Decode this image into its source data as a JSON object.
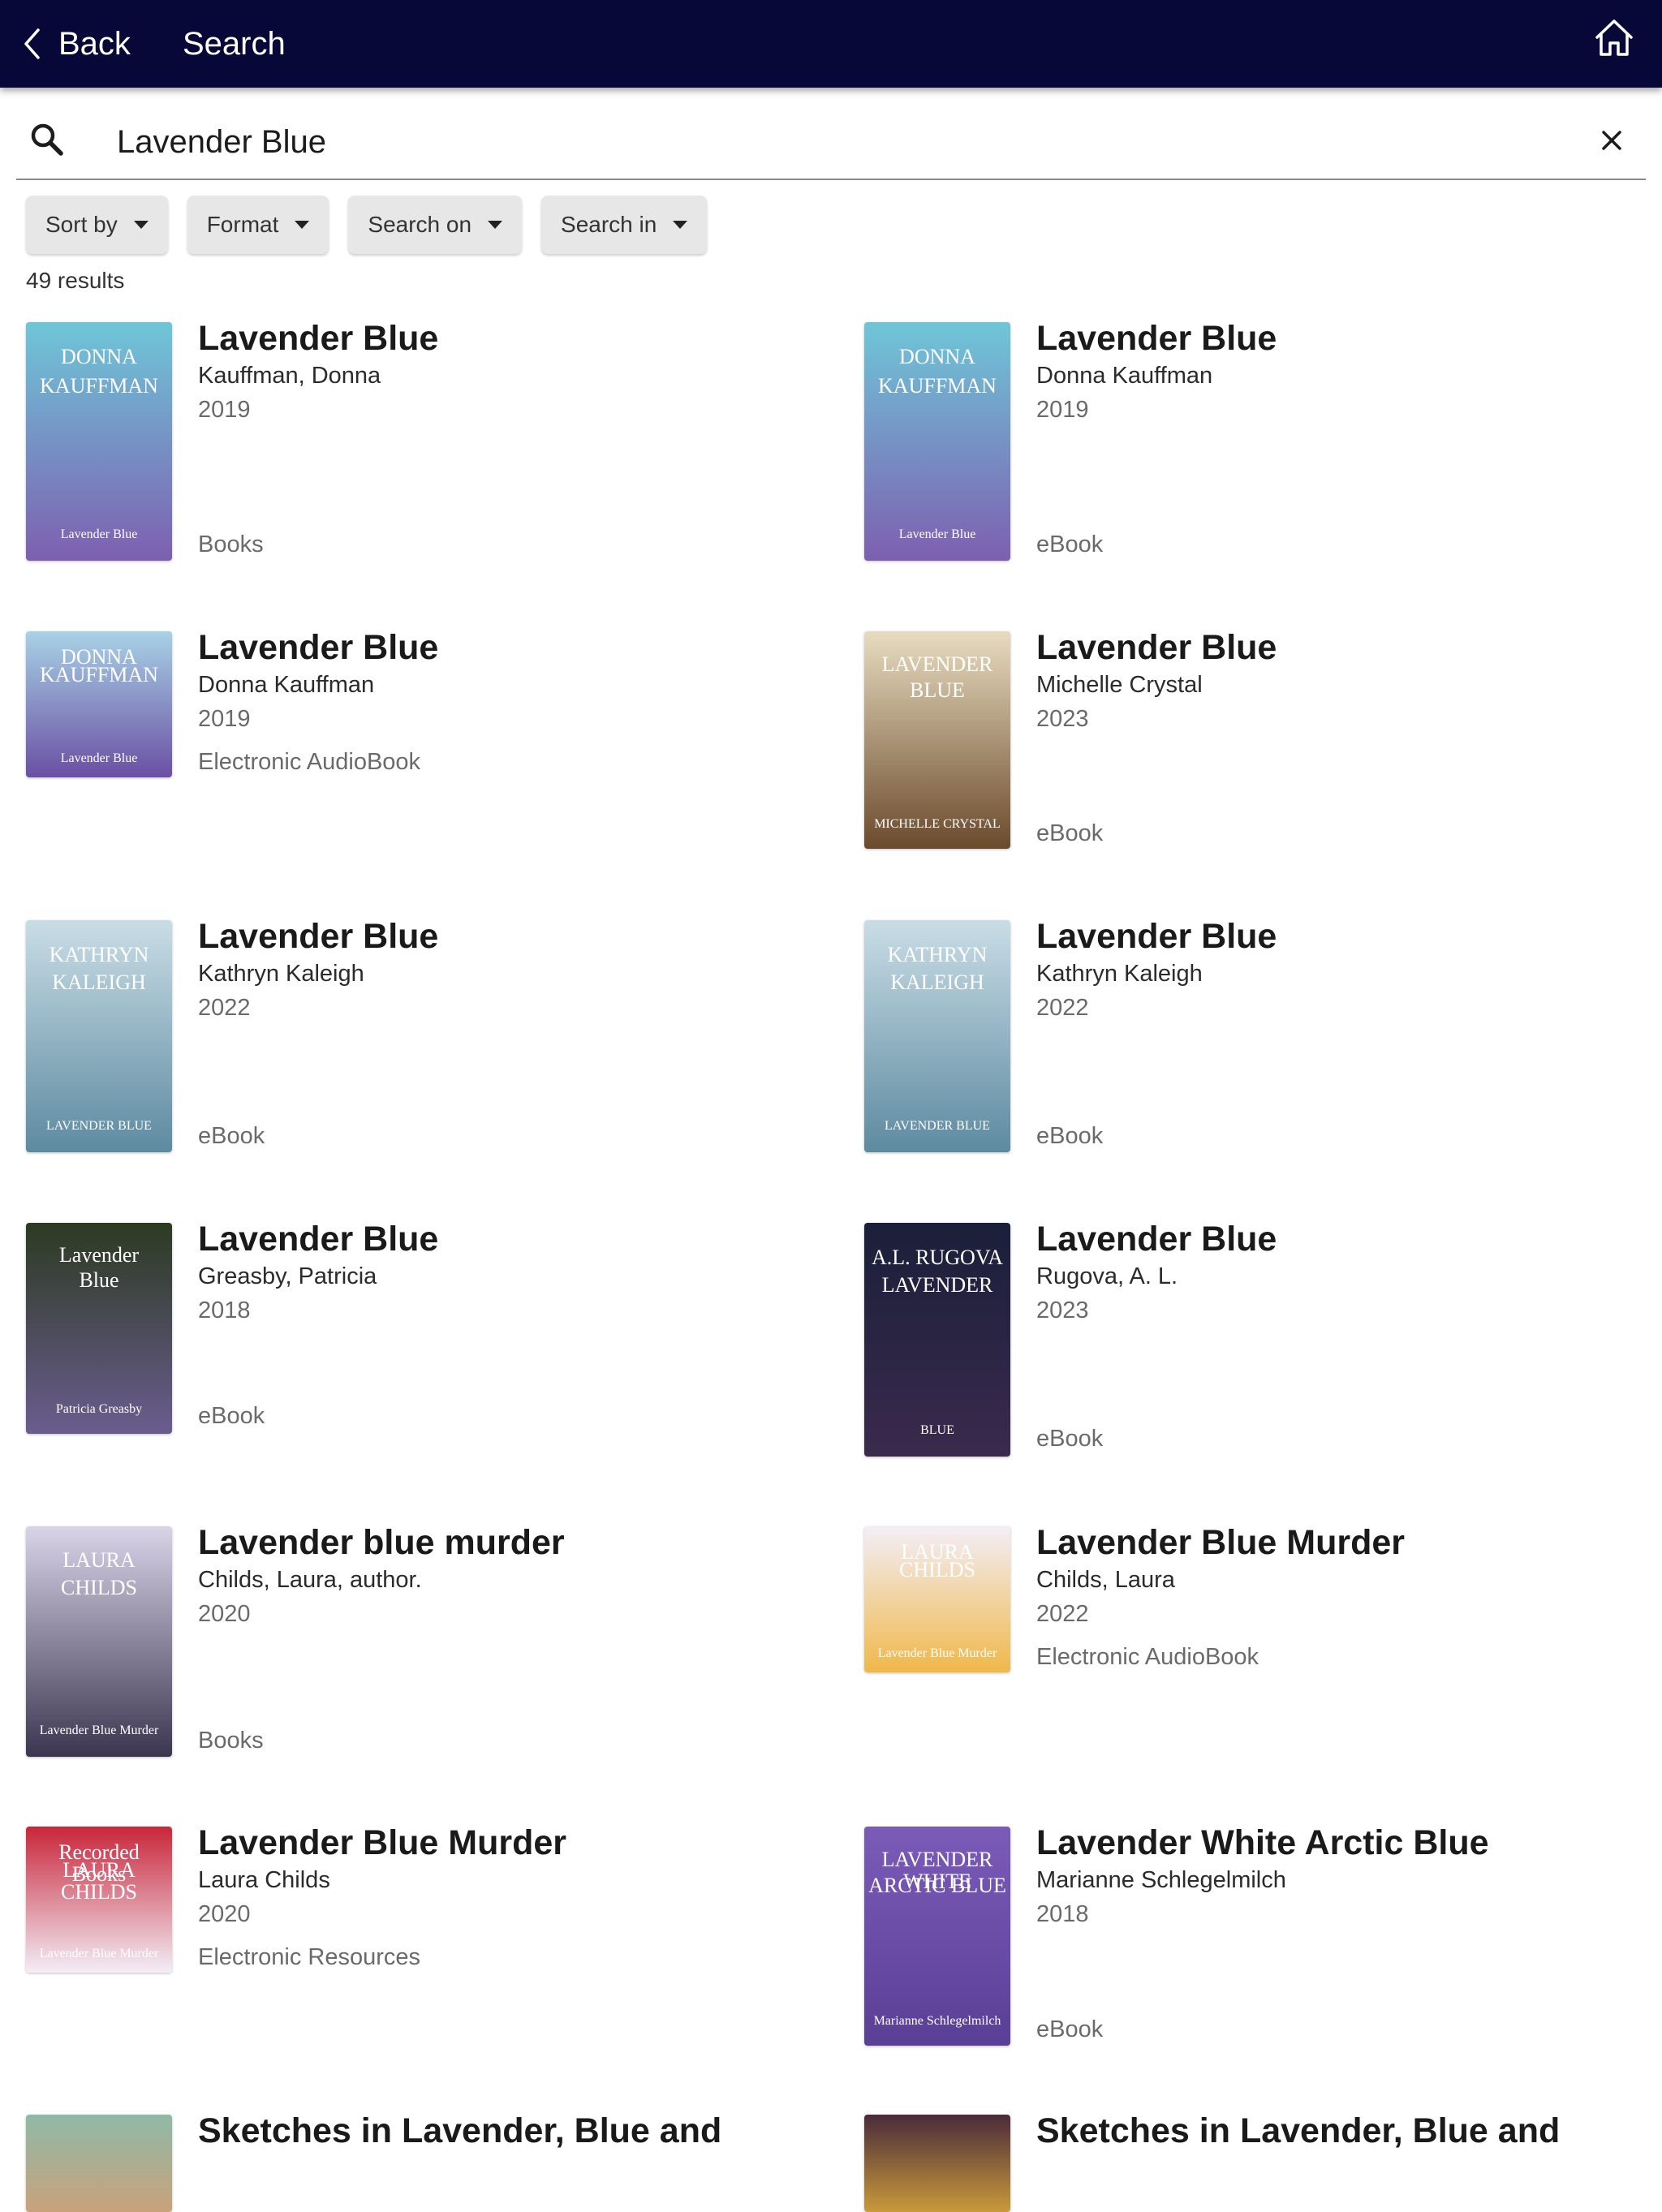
{
  "header": {
    "back_label": "Back",
    "title": "Search"
  },
  "search": {
    "query": "Lavender Blue"
  },
  "filters": [
    "Sort by",
    "Format",
    "Search on",
    "Search in"
  ],
  "result_count": "49 results",
  "results": [
    {
      "title": "Lavender Blue",
      "author": "Kauffman, Donna",
      "year": "2019",
      "format": "Books",
      "cover": {
        "line1": "DONNA",
        "line2": "KAUFFMAN",
        "line3": "Lavender Blue",
        "top": "#6fc6d8",
        "bottom": "#7d5fb0"
      }
    },
    {
      "title": "Lavender Blue",
      "author": "Donna Kauffman",
      "year": "2019",
      "format": "eBook",
      "cover": {
        "line1": "DONNA",
        "line2": "KAUFFMAN",
        "line3": "Lavender Blue",
        "top": "#6fc6d8",
        "bottom": "#7d5fb0"
      }
    },
    {
      "title": "Lavender Blue",
      "author": "Donna Kauffman",
      "year": "2019",
      "format": "Electronic AudioBook",
      "cover": {
        "line1": "DONNA",
        "line2": "KAUFFMAN",
        "line3": "Lavender Blue",
        "top": "#a8d2e6",
        "bottom": "#6a4fa3"
      }
    },
    {
      "title": "Lavender Blue",
      "author": "Michelle Crystal",
      "year": "2023",
      "format": "eBook",
      "cover": {
        "line1": "LAVENDER",
        "line2": "BLUE",
        "line3": "MICHELLE CRYSTAL",
        "top": "#e8dcc0",
        "bottom": "#6b4a2c"
      }
    },
    {
      "title": "Lavender Blue",
      "author": "Kathryn Kaleigh",
      "year": "2022",
      "format": "eBook",
      "cover": {
        "line1": "KATHRYN",
        "line2": "KALEIGH",
        "line3": "LAVENDER BLUE",
        "top": "#c9dde6",
        "bottom": "#5d8aa0"
      }
    },
    {
      "title": "Lavender Blue",
      "author": "Kathryn Kaleigh",
      "year": "2022",
      "format": "eBook",
      "cover": {
        "line1": "KATHRYN",
        "line2": "KALEIGH",
        "line3": "LAVENDER BLUE",
        "top": "#c9dde6",
        "bottom": "#5d8aa0"
      }
    },
    {
      "title": "Lavender Blue",
      "author": "Greasby, Patricia",
      "year": "2018",
      "format": "eBook",
      "cover": {
        "line1": "Lavender",
        "line2": "Blue",
        "line3": "Patricia Greasby",
        "top": "#2c3a22",
        "bottom": "#6a5d8f"
      }
    },
    {
      "title": "Lavender Blue",
      "author": "Rugova, A. L.",
      "year": "2023",
      "format": "eBook",
      "cover": {
        "line1": "A.L. RUGOVA",
        "line2": "LAVENDER",
        "line3": "BLUE",
        "top": "#1a1f3a",
        "bottom": "#3b2a4d"
      }
    },
    {
      "title": "Lavender blue murder",
      "author": "Childs, Laura, author.",
      "year": "2020",
      "format": "Books",
      "cover": {
        "line1": "LAURA",
        "line2": "CHILDS",
        "line3": "Lavender Blue Murder",
        "top": "#d9d4e8",
        "bottom": "#3c3550"
      }
    },
    {
      "title": "Lavender Blue Murder",
      "author": "Childs, Laura",
      "year": "2022",
      "format": "Electronic AudioBook",
      "cover": {
        "line1": "LAURA",
        "line2": "CHILDS",
        "line3": "Lavender Blue Murder",
        "top": "#f3eef7",
        "bottom": "#f0b84a"
      }
    },
    {
      "title": "Lavender Blue Murder",
      "author": "Laura Childs",
      "year": "2020",
      "format": "Electronic Resources",
      "cover": {
        "line1": "Recorded Books",
        "line2": "LAURA CHILDS",
        "line3": "Lavender Blue Murder",
        "top": "#c8263a",
        "bottom": "#f3eef7"
      }
    },
    {
      "title": "Lavender White Arctic Blue",
      "author": "Marianne Schlegelmilch",
      "year": "2018",
      "format": "eBook",
      "cover": {
        "line1": "LAVENDER WHITE",
        "line2": "ARCTIC BLUE",
        "line3": "Marianne Schlegelmilch",
        "top": "#7b5bb8",
        "bottom": "#5a3f96"
      }
    },
    {
      "title": "Sketches in Lavender, Blue and",
      "author": "",
      "year": "",
      "format": "",
      "cover": {
        "line1": "",
        "line2": "",
        "line3": "",
        "top": "#8fb9a8",
        "bottom": "#c9a27a"
      }
    },
    {
      "title": "Sketches in Lavender, Blue and",
      "author": "",
      "year": "",
      "format": "",
      "cover": {
        "line1": "",
        "line2": "",
        "line3": "",
        "top": "#4a2a3a",
        "bottom": "#c99a3a"
      }
    }
  ]
}
